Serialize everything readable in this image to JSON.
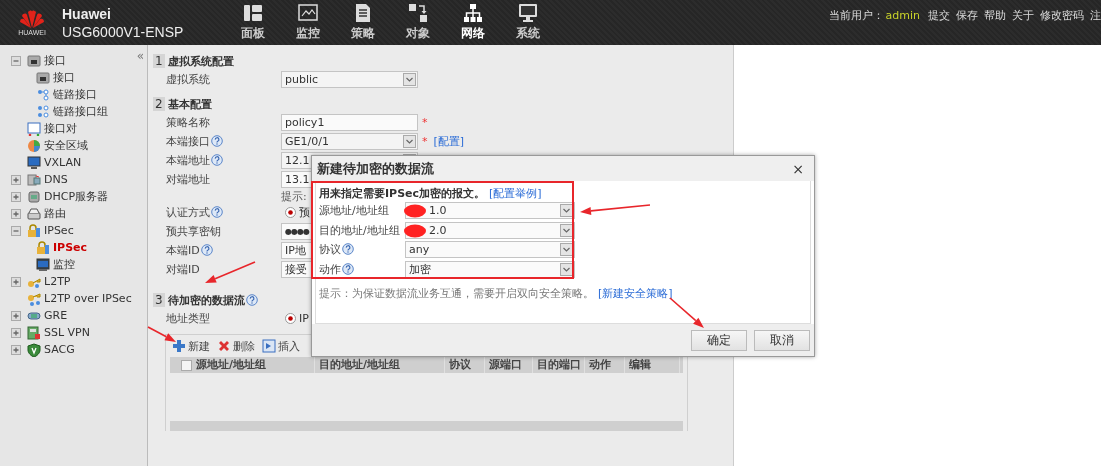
{
  "header": {
    "logo_text": "HUAWEI",
    "brand": "Huawei",
    "model": "USG6000V1-ENSP",
    "nav": [
      {
        "label": "面板",
        "selected": false
      },
      {
        "label": "监控",
        "selected": false
      },
      {
        "label": "策略",
        "selected": false
      },
      {
        "label": "对象",
        "selected": false
      },
      {
        "label": "网络",
        "selected": true
      },
      {
        "label": "系统",
        "selected": false
      }
    ],
    "user_label": "当前用户：",
    "user": "admin",
    "links": [
      "提交",
      "保存",
      "帮助",
      "关于",
      "修改密码",
      "注"
    ]
  },
  "sidebar": {
    "collapse": "«",
    "items": [
      {
        "label": "接口",
        "expanded": true,
        "selected": false,
        "children": [
          {
            "label": "接口",
            "selected": false
          },
          {
            "label": "链路接口",
            "selected": false
          },
          {
            "label": "链路接口组",
            "selected": false
          }
        ]
      },
      {
        "label": "接口对",
        "selected": false
      },
      {
        "label": "安全区域",
        "selected": false
      },
      {
        "label": "VXLAN",
        "selected": false
      },
      {
        "label": "DNS",
        "expanded": false,
        "selected": false
      },
      {
        "label": "DHCP服务器",
        "expanded": false,
        "selected": false
      },
      {
        "label": "路由",
        "expanded": false,
        "selected": false
      },
      {
        "label": "IPSec",
        "expanded": true,
        "selected": false,
        "children": [
          {
            "label": "IPSec",
            "selected": true
          },
          {
            "label": "监控",
            "selected": false
          }
        ]
      },
      {
        "label": "L2TP",
        "expanded": false,
        "selected": false
      },
      {
        "label": "L2TP over IPSec",
        "selected": false
      },
      {
        "label": "GRE",
        "expanded": false,
        "selected": false
      },
      {
        "label": "SSL VPN",
        "expanded": false,
        "selected": false
      },
      {
        "label": "SACG",
        "expanded": false,
        "selected": false
      }
    ]
  },
  "form": {
    "sections": [
      {
        "number": "1",
        "title": "虚拟系统配置",
        "help": false,
        "fields": [
          {
            "label": "虚拟系统",
            "help": false,
            "kind": "select",
            "value": "public"
          }
        ]
      },
      {
        "number": "2",
        "title": "基本配置",
        "help": false,
        "fields": [
          {
            "label": "策略名称",
            "help": false,
            "kind": "input",
            "value": "policy1",
            "required_mark": "*"
          },
          {
            "label": "本端接口",
            "help": true,
            "kind": "select",
            "value": "GE1/0/1",
            "required_mark": "*",
            "link": "[配置]"
          },
          {
            "label": "本端地址",
            "help": true,
            "kind": "select",
            "value": "12.1"
          },
          {
            "label": "对端地址",
            "help": false,
            "kind": "input",
            "value": "13.1"
          },
          {
            "kind": "hint",
            "value": "提示:"
          },
          {
            "label": "认证方式",
            "help": true,
            "kind": "radio",
            "selected": true,
            "value": "预"
          },
          {
            "label": "预共享密钥",
            "help": false,
            "kind": "input",
            "value": "●●●●"
          },
          {
            "label": "本端ID",
            "help": true,
            "kind": "input",
            "value": "IP地"
          },
          {
            "label": "对端ID",
            "help": false,
            "kind": "input",
            "value": "接受"
          }
        ]
      },
      {
        "number": "3",
        "title": "待加密的数据流",
        "help": true,
        "fields": [
          {
            "label": "地址类型",
            "help": false,
            "kind": "radio",
            "selected": true,
            "value": "IP"
          }
        ]
      }
    ]
  },
  "toolbar": [
    {
      "label": "新建"
    },
    {
      "label": "删除"
    },
    {
      "label": "插入"
    }
  ],
  "table": {
    "checked": false,
    "columns": [
      "源地址/地址组",
      "目的地址/地址组",
      "协议",
      "源端口",
      "目的端口",
      "动作",
      "编辑"
    ]
  },
  "dialog": {
    "title": "新建待加密的数据流",
    "close": "×",
    "intro": "用来指定需要IPSec加密的报文。",
    "intro_link": "[配置举例]",
    "fields": [
      {
        "label": "源地址/地址组",
        "help": false,
        "value": "1.0",
        "redacted": true
      },
      {
        "label": "目的地址/地址组",
        "help": false,
        "value": "2.0",
        "redacted": true
      },
      {
        "label": "协议",
        "help": true,
        "value": "any",
        "redacted": false
      },
      {
        "label": "动作",
        "help": true,
        "value": "加密",
        "redacted": false
      }
    ],
    "hint": "提示：为保证数据流业务互通，需要开启双向安全策略。",
    "hint_link": "[新建安全策略]",
    "buttons": [
      "确定",
      "取消"
    ]
  },
  "annotations": [
    {
      "kind": "frame"
    },
    {
      "kind": "arrow"
    },
    {
      "kind": "arrow"
    },
    {
      "kind": "arrow"
    },
    {
      "kind": "arrow"
    }
  ]
}
